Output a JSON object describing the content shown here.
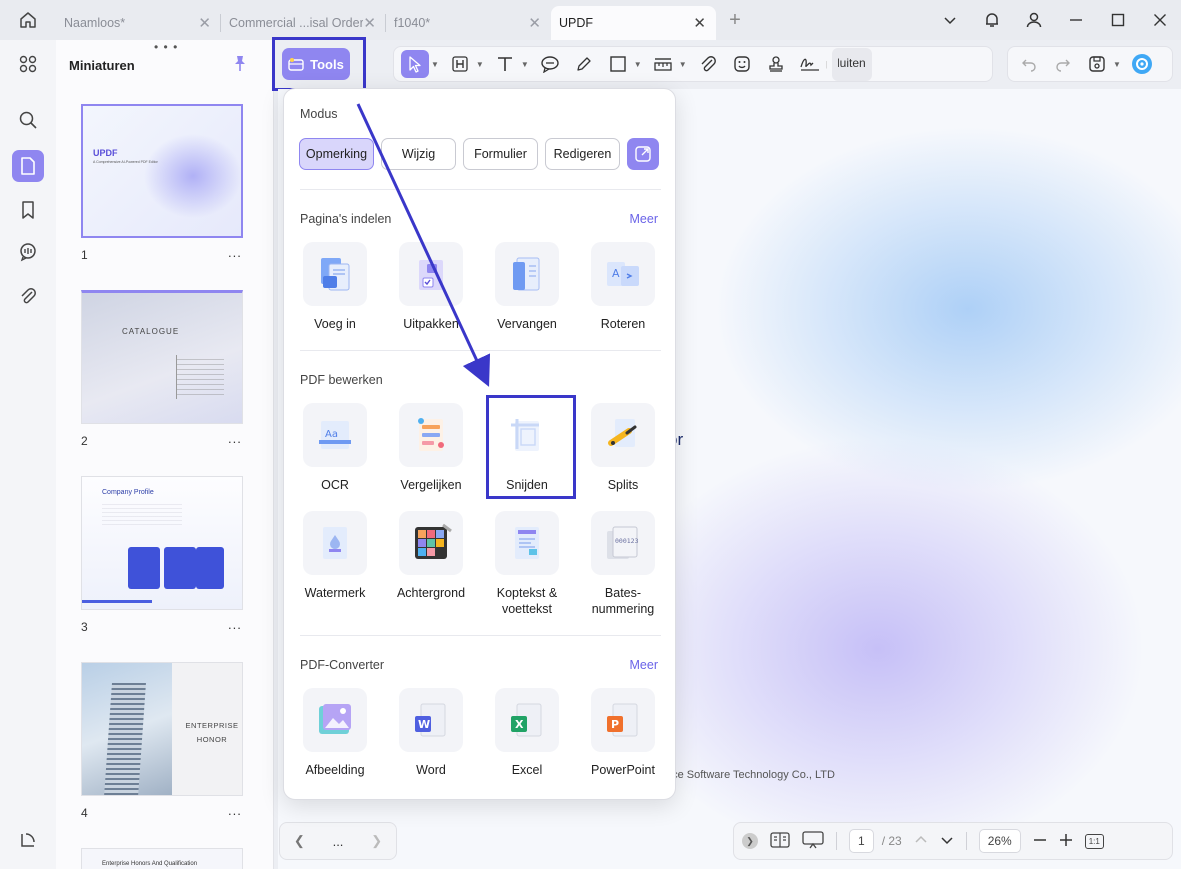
{
  "tabs": [
    {
      "label": "Naamloos*",
      "active": false
    },
    {
      "label": "Commercial ...isal Order*",
      "active": false
    },
    {
      "label": "f1040*",
      "active": false
    },
    {
      "label": "UPDF",
      "active": true
    }
  ],
  "sidebar": {
    "title": "Miniaturen",
    "pages": [
      {
        "number": "1",
        "title": "UPDF",
        "subtitle": "A Comprehensive AI-Powered PDF Editor"
      },
      {
        "number": "2",
        "title": "CATALOGUE"
      },
      {
        "number": "3",
        "title": "Company Profile"
      },
      {
        "number": "4",
        "title": "ENTERPRISE HONOR"
      },
      {
        "number": "5",
        "title": "Enterprise Honors And Qualification"
      }
    ],
    "more": "..."
  },
  "toolbar": {
    "tools_label": "Tools",
    "sluiten_label": "Sluiten"
  },
  "panel": {
    "modus_title": "Modus",
    "modes": [
      "Opmerking",
      "Wijzig",
      "Formulier",
      "Redigeren"
    ],
    "pagina_title": "Pagina's indelen",
    "pagina_more": "Meer",
    "pagina_tools": [
      "Voeg in",
      "Uitpakken",
      "Vervangen",
      "Roteren"
    ],
    "bewerken_title": "PDF bewerken",
    "bewerken_tools": [
      "OCR",
      "Vergelijken",
      "Snijden",
      "Splits",
      "Watermerk",
      "Achtergrond",
      "Koptekst & voettekst",
      "Bates-nummering"
    ],
    "converter_title": "PDF-Converter",
    "converter_more": "Meer",
    "converter_tools": [
      "Afbeelding",
      "Word",
      "Excel",
      "PowerPoint"
    ]
  },
  "document": {
    "fragment": "or",
    "footer": "nce Software Technology Co., LTD"
  },
  "navbar": {
    "more": "..."
  },
  "statusbar": {
    "current_page": "1",
    "total_pages": "/ 23",
    "zoom": "26%",
    "fit": "1:1"
  },
  "colors": {
    "accent": "#8f86f0",
    "highlight": "#3a37c9"
  }
}
